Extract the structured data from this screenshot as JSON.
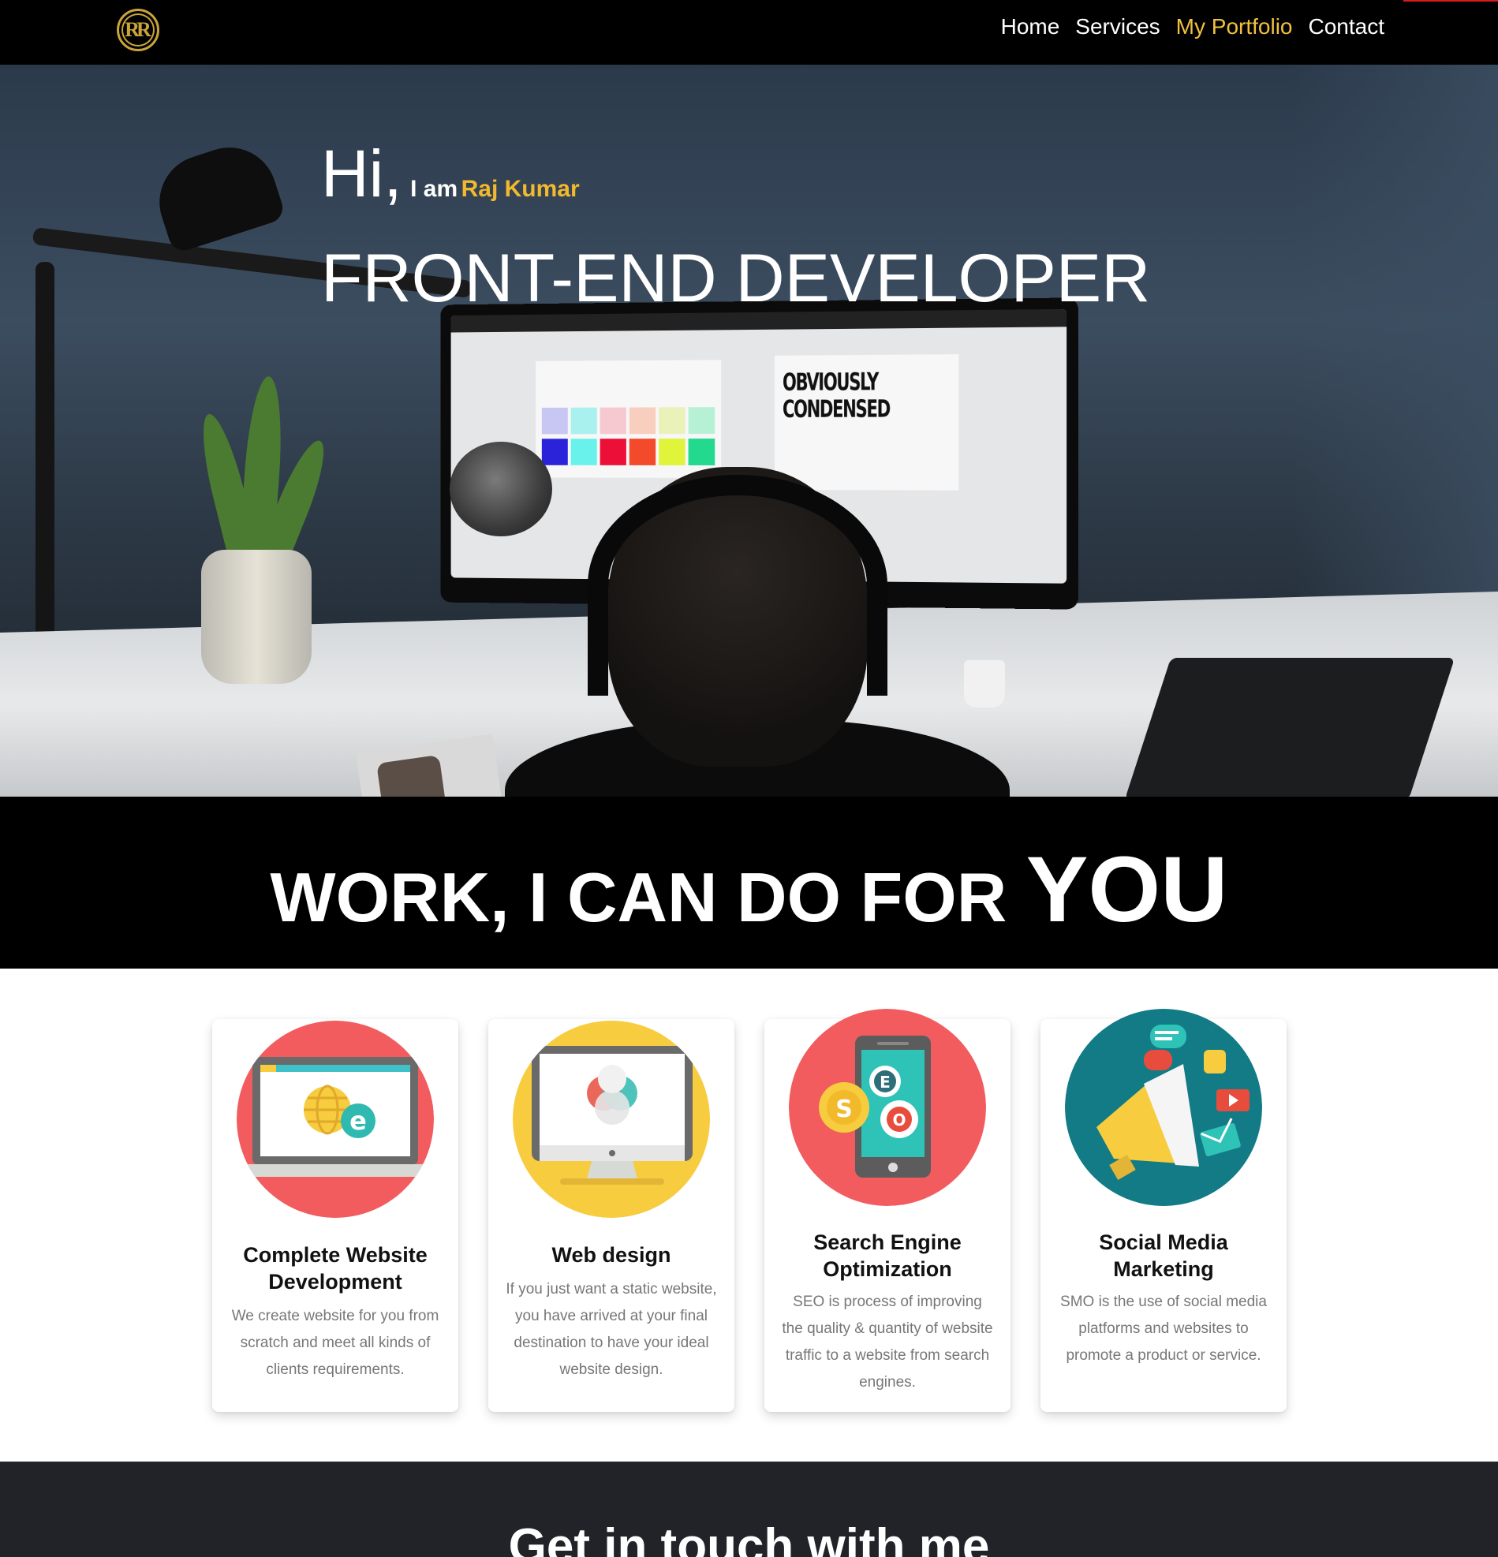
{
  "navbar": {
    "logo_text": "RR",
    "links": [
      {
        "label": "Home"
      },
      {
        "label": "Services"
      },
      {
        "label": "My Portfolio"
      },
      {
        "label": "Contact"
      }
    ],
    "active_link": "My Portfolio",
    "accent_color": "#f0c040"
  },
  "hero": {
    "greeting": "Hi,",
    "intro": "I am",
    "name": "Raj Kumar",
    "role": "FRONT-END DEVELOPER",
    "monitor_text": "OBVIOUSLY CONDENSED",
    "name_color": "#f1b92d"
  },
  "work": {
    "title": "WORK, I CAN DO FOR",
    "emphasis": "YOU"
  },
  "services": [
    {
      "title": "Complete Website Development",
      "description": "We create website for you from scratch and meet all kinds of clients requirements.",
      "icon": "laptop-globe-icon",
      "icon_bg": "#f25c5f"
    },
    {
      "title": "Web design",
      "description": "If you just want a static website, you have arrived at your final destination to have your ideal website design.",
      "icon": "monitor-design-icon",
      "icon_bg": "#f7cc3f"
    },
    {
      "title": "Search Engine Optimization",
      "description": "SEO is process of improving the quality & quantity of website traffic to a website from search engines.",
      "icon": "seo-phone-gears-icon",
      "icon_bg": "#f25c5f"
    },
    {
      "title": "Social Media Marketing",
      "description": "SMO is the use of social media platforms and websites to promote a product or service.",
      "icon": "megaphone-icon",
      "icon_bg": "#127b86"
    }
  ],
  "contact": {
    "title": "Get in touch with me"
  }
}
